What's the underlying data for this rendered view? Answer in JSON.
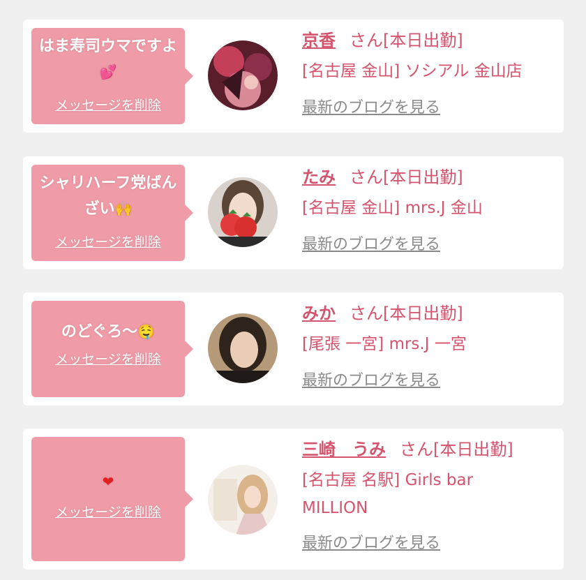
{
  "cards": [
    {
      "message": "はま寿司ウマですよ",
      "emoji": "💕",
      "delete_label": "メッセージを削除",
      "name": "京香",
      "suffix": "さん[本日出勤]",
      "shop": "[名古屋 金山] ソシアル 金山店",
      "blog_label": "最新のブログを見る"
    },
    {
      "message": "シャリハーフ党ばんざい",
      "emoji": "🙌",
      "delete_label": "メッセージを削除",
      "name": "たみ",
      "suffix": "さん[本日出勤]",
      "shop": "[名古屋 金山] mrs.J 金山",
      "blog_label": "最新のブログを見る"
    },
    {
      "message": "のどぐろ〜",
      "emoji": "🤤",
      "delete_label": "メッセージを削除",
      "name": "みか",
      "suffix": "さん[本日出勤]",
      "shop": "[尾張 一宮] mrs.J 一宮",
      "blog_label": "最新のブログを見る"
    },
    {
      "message": "",
      "emoji": "❤",
      "delete_label": "メッセージを削除",
      "name": "三崎　うみ",
      "suffix": "さん[本日出勤]",
      "shop": "[名古屋 名駅] Girls bar MILLION",
      "blog_label": "最新のブログを見る"
    }
  ],
  "colors": {
    "background": "#f0f0f0",
    "bubble": "#ef9ca8",
    "accent": "#d4546d",
    "link_gray": "#8a8a8a"
  }
}
